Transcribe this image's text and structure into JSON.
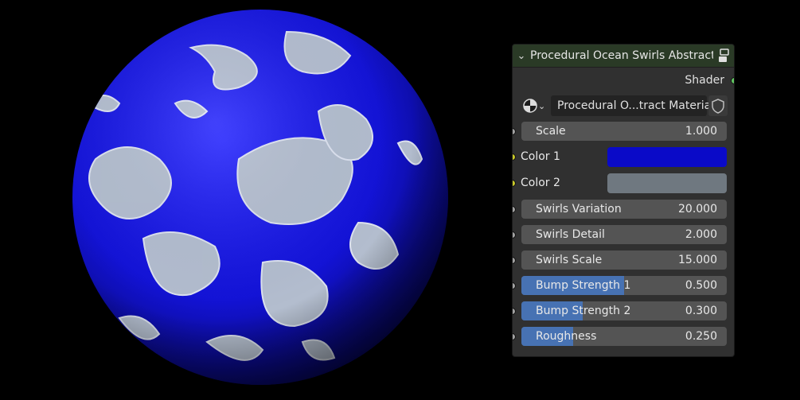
{
  "node": {
    "title": "Procedural Ocean Swirls Abstract ...",
    "output_label": "Shader",
    "material_name": "Procedural O...tract Material",
    "header_color": "#2a3a26",
    "shader_socket_color": "#63c763",
    "float_socket_color": "#a1a1a1",
    "color_socket_color": "#c7c729",
    "icons": [
      "chevron-down-icon",
      "node-group-icon",
      "material-sphere-icon",
      "fake-user-shield-icon"
    ],
    "inputs": [
      {
        "kind": "float",
        "label": "Scale",
        "value": "1.000"
      },
      {
        "kind": "color",
        "label": "Color 1",
        "color": "#0a0ac8"
      },
      {
        "kind": "color",
        "label": "Color 2",
        "color": "#6f7880"
      },
      {
        "kind": "float",
        "label": "Swirls Variation",
        "value": "20.000"
      },
      {
        "kind": "float",
        "label": "Swirls Detail",
        "value": "2.000"
      },
      {
        "kind": "float",
        "label": "Swirls Scale",
        "value": "15.000"
      },
      {
        "kind": "factor",
        "label": "Bump Strength 1",
        "value": "0.500",
        "fraction": 0.5
      },
      {
        "kind": "factor",
        "label": "Bump Strength 2",
        "value": "0.300",
        "fraction": 0.3
      },
      {
        "kind": "factor",
        "label": "Roughness",
        "value": "0.250",
        "fraction": 0.25
      }
    ]
  }
}
